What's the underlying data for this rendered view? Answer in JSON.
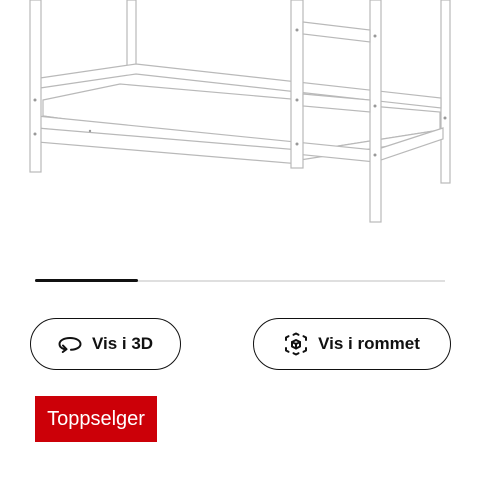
{
  "product": {
    "image_alt": "Køyeseng i hvit med madrass"
  },
  "carousel": {
    "progress": 0.25
  },
  "actions": {
    "view_3d_label": "Vis i 3D",
    "view_3d_icon": "rotate-3d-icon",
    "view_room_label": "Vis i rommet",
    "view_room_icon": "ar-cube-icon"
  },
  "badge": {
    "label": "Toppselger",
    "color": "#cc0008"
  },
  "colors": {
    "frame": "#ffffff",
    "outline": "#b8b8b8",
    "text": "#111111"
  }
}
